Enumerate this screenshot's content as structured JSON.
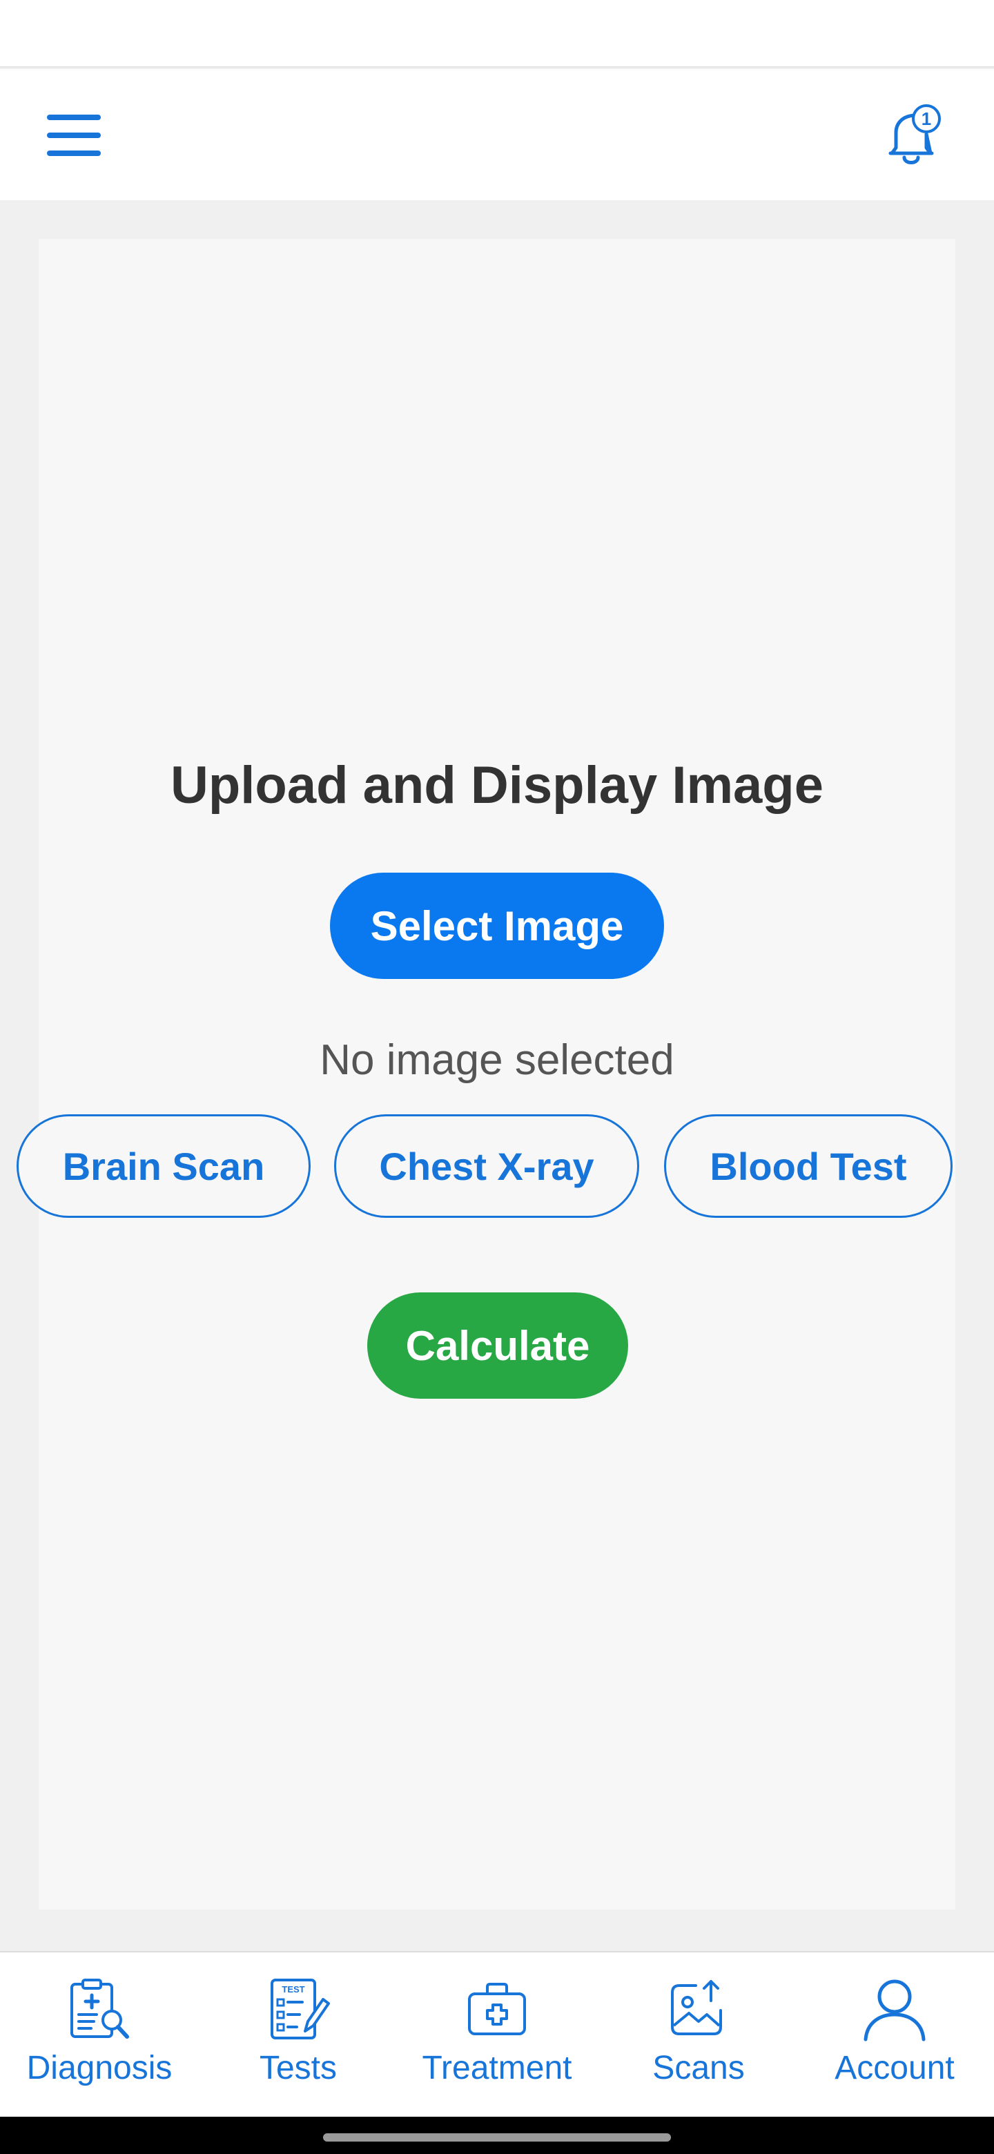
{
  "colors": {
    "primary": "#0a79f0",
    "outline": "#1774d9",
    "success": "#28a745",
    "background": "#f0f0f0",
    "card": "#f7f7f7"
  },
  "app_bar": {
    "menu_icon": "hamburger-menu-icon",
    "notification_icon": "bell-icon",
    "notification_count": "1"
  },
  "main": {
    "title": "Upload and Display Image",
    "select_button": "Select Image",
    "status_text": "No image selected",
    "scan_types": [
      {
        "label": "Brain Scan"
      },
      {
        "label": "Chest X-ray"
      },
      {
        "label": "Blood Test"
      }
    ],
    "calculate_button": "Calculate"
  },
  "bottom_nav": {
    "items": [
      {
        "label": "Diagnosis",
        "icon": "clipboard-search-icon"
      },
      {
        "label": "Tests",
        "icon": "test-checklist-icon"
      },
      {
        "label": "Treatment",
        "icon": "first-aid-kit-icon"
      },
      {
        "label": "Scans",
        "icon": "image-upload-icon"
      },
      {
        "label": "Account",
        "icon": "user-icon"
      }
    ]
  }
}
